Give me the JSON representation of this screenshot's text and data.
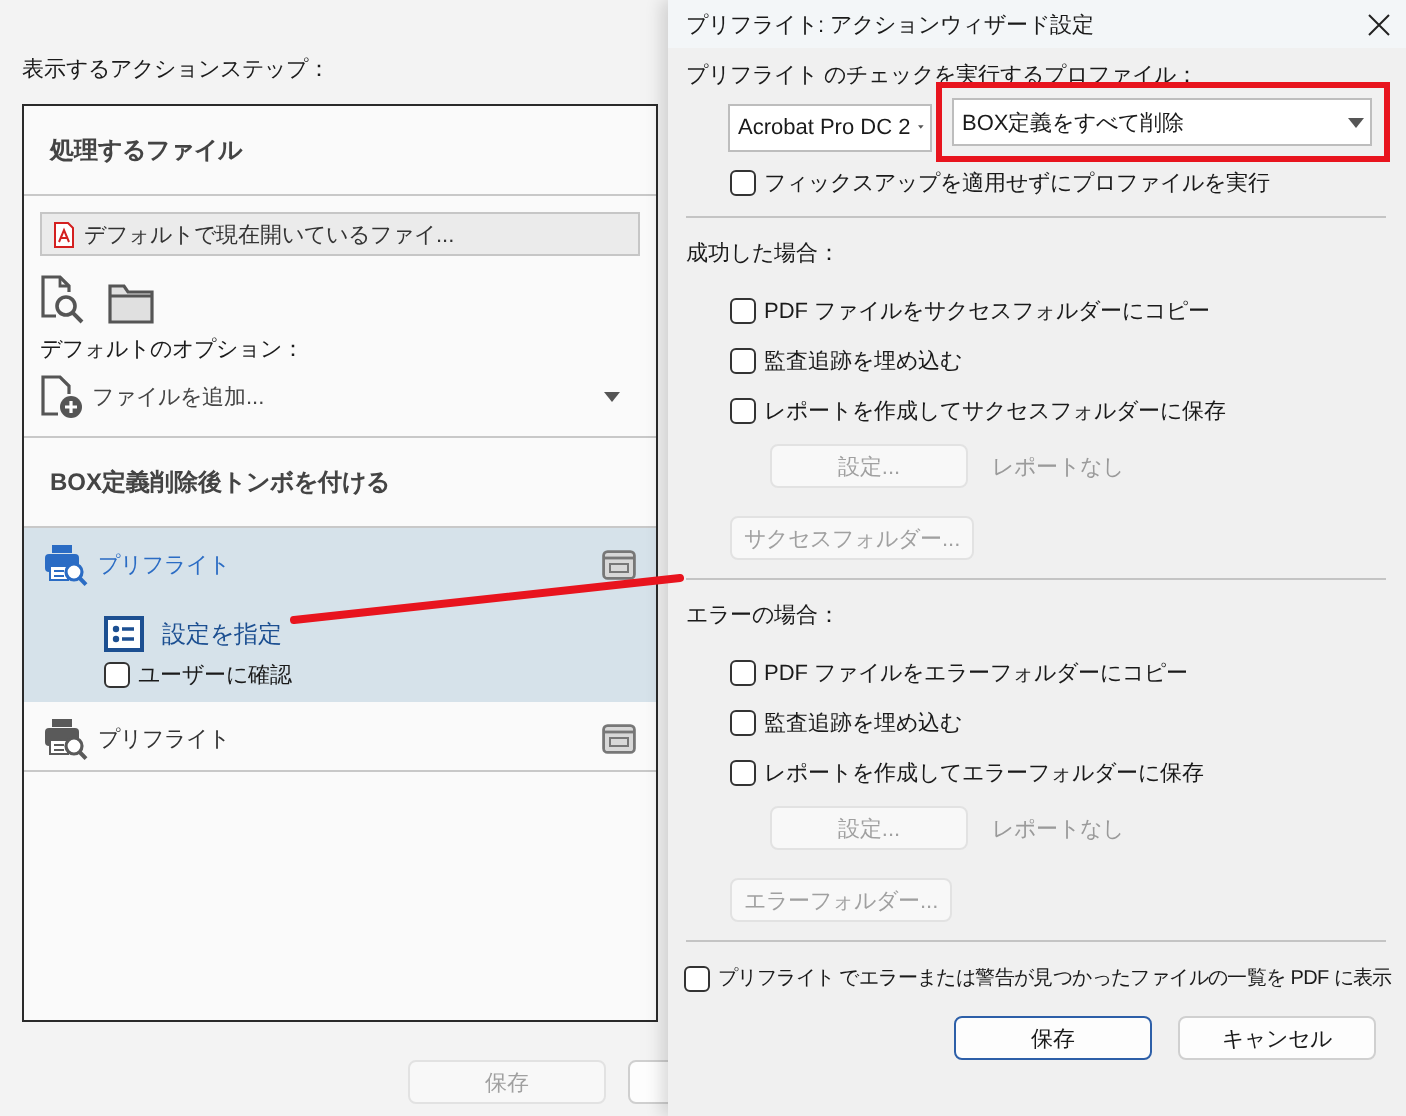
{
  "back_window": {
    "section_label": "表示するアクションステップ：",
    "file_group": {
      "heading": "処理するファイル",
      "source_field": "デフォルトで現在開いているファイ...",
      "options_label": "デフォルトのオプション：",
      "add_dropdown": "ファイルを追加..."
    },
    "action_group": {
      "heading": "BOX定義削除後トンボを付ける"
    },
    "steps": [
      {
        "label": "プリフライト",
        "selected": true,
        "settings_link": "設定を指定",
        "confirm": {
          "label": "ユーザーに確認",
          "checked": false
        }
      },
      {
        "label": "プリフライト",
        "selected": false
      }
    ],
    "buttons": [
      {
        "label": "保存",
        "disabled": true
      }
    ]
  },
  "dialog": {
    "title": "プリフライト: アクションウィザード設定",
    "profile_label": "プリフライト のチェックを実行するプロファイル：",
    "version_dropdown": "Acrobat Pro DC 2",
    "profile_dropdown": "BOX定義をすべて削除",
    "no_fixup": {
      "label": "フィックスアップを適用せずにプロファイルを実行",
      "checked": false
    },
    "sections": [
      {
        "heading": "成功した場合：",
        "checks": [
          {
            "label": "PDF ファイルをサクセスフォルダーにコピー",
            "checked": false
          },
          {
            "label": "監査追跡を埋め込む",
            "checked": false
          },
          {
            "label": "レポートを作成してサクセスフォルダーに保存",
            "checked": false
          }
        ],
        "settings_button": {
          "label": "設定...",
          "disabled": true
        },
        "report_status": "レポートなし",
        "folder_button": {
          "label": "サクセスフォルダー...",
          "disabled": true
        }
      },
      {
        "heading": "エラーの場合：",
        "checks": [
          {
            "label": "PDF ファイルをエラーフォルダーにコピー",
            "checked": false
          },
          {
            "label": "監査追跡を埋め込む",
            "checked": false
          },
          {
            "label": "レポートを作成してエラーフォルダーに保存",
            "checked": false
          }
        ],
        "settings_button": {
          "label": "設定...",
          "disabled": true
        },
        "report_status": "レポートなし",
        "folder_button": {
          "label": "エラーフォルダー...",
          "disabled": true
        }
      }
    ],
    "list_errors": {
      "label": "プリフライト でエラーまたは警告が見つかったファイルの一覧を PDF に表示",
      "checked": false
    },
    "buttons": [
      {
        "label": "保存",
        "disabled": false,
        "default": true
      },
      {
        "label": "キャンセル",
        "disabled": false,
        "default": false
      }
    ]
  }
}
